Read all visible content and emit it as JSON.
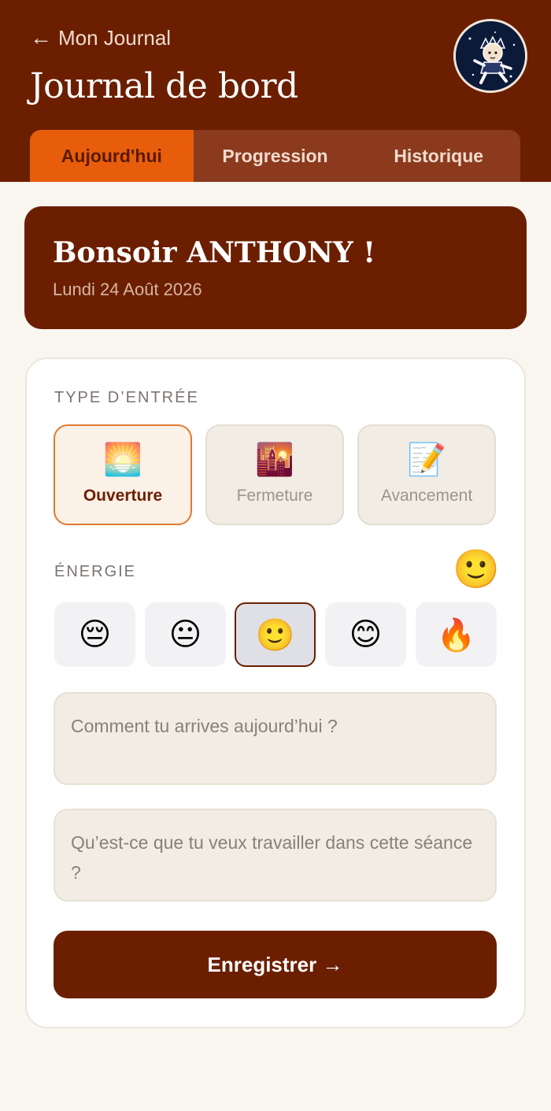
{
  "header": {
    "back_label": "Mon Journal",
    "title": "Journal de bord",
    "tabs": [
      {
        "label": "Aujourd'hui",
        "active": true
      },
      {
        "label": "Progression",
        "active": false
      },
      {
        "label": "Historique",
        "active": false
      }
    ]
  },
  "greeting": {
    "title": "Bonsoir ANTHONY !",
    "date": "Lundi 24 Août 2026"
  },
  "entry_type": {
    "label": "TYPE D’ENTRÉE",
    "options": [
      {
        "label": "Ouverture",
        "emoji": "🌅",
        "selected": true
      },
      {
        "label": "Fermeture",
        "emoji": "🌇",
        "selected": false
      },
      {
        "label": "Avancement",
        "emoji": "📝",
        "selected": false
      }
    ]
  },
  "energy": {
    "label": "ÉNERGIE",
    "current_emoji": "🙂",
    "levels": [
      {
        "emoji": "😔",
        "selected": false
      },
      {
        "emoji": "😐",
        "selected": false
      },
      {
        "emoji": "🙂",
        "selected": true
      },
      {
        "emoji": "😊",
        "selected": false
      },
      {
        "emoji": "🔥",
        "selected": false
      }
    ]
  },
  "inputs": {
    "arrival_placeholder": "Comment tu arrives aujourd’hui ?",
    "goal_placeholder": "Qu’est-ce que tu veux travailler dans cette séance ?"
  },
  "actions": {
    "save_label": "Enregistrer →"
  },
  "colors": {
    "brand": "#6b1f00",
    "accent": "#e85d0c",
    "background": "#f9f5ef"
  }
}
